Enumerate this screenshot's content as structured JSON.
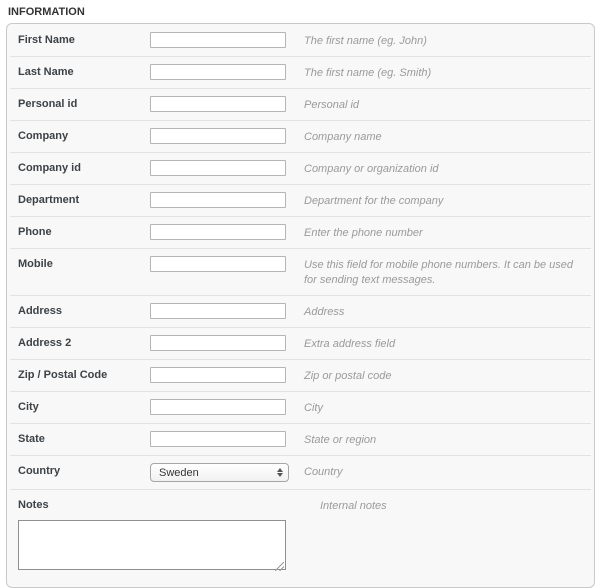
{
  "section": {
    "title": "INFORMATION"
  },
  "colors": {
    "panel_background": "#f8f8f8",
    "panel_border": "#c9c9c9",
    "row_separator": "#e2e2e2",
    "label_text": "#3c4247",
    "help_text": "#9a9a9a",
    "input_border": "#b5b5b5"
  },
  "form": {
    "rows": [
      {
        "label": "First Name",
        "help": "The first name (eg. John)",
        "type": "text",
        "value": ""
      },
      {
        "label": "Last Name",
        "help": "The first name (eg. Smith)",
        "type": "text",
        "value": ""
      },
      {
        "label": "Personal id",
        "help": "Personal id",
        "type": "text",
        "value": ""
      },
      {
        "label": "Company",
        "help": "Company name",
        "type": "text",
        "value": ""
      },
      {
        "label": "Company id",
        "help": "Company or organization id",
        "type": "text",
        "value": ""
      },
      {
        "label": "Department",
        "help": "Department for the company",
        "type": "text",
        "value": ""
      },
      {
        "label": "Phone",
        "help": "Enter the phone number",
        "type": "text",
        "value": ""
      },
      {
        "label": "Mobile",
        "help": "Use this field for mobile phone numbers. It can be used for sending text messages.",
        "type": "text",
        "value": ""
      },
      {
        "label": "Address",
        "help": "Address",
        "type": "text",
        "value": ""
      },
      {
        "label": "Address 2",
        "help": "Extra address field",
        "type": "text",
        "value": ""
      },
      {
        "label": "Zip / Postal Code",
        "help": "Zip or postal code",
        "type": "text",
        "value": ""
      },
      {
        "label": "City",
        "help": "City",
        "type": "text",
        "value": ""
      },
      {
        "label": "State",
        "help": "State or region",
        "type": "text",
        "value": ""
      },
      {
        "label": "Country",
        "help": "Country",
        "type": "select",
        "value": "Sweden"
      },
      {
        "label": "Notes",
        "help": "Internal notes",
        "type": "textarea",
        "value": ""
      }
    ]
  }
}
